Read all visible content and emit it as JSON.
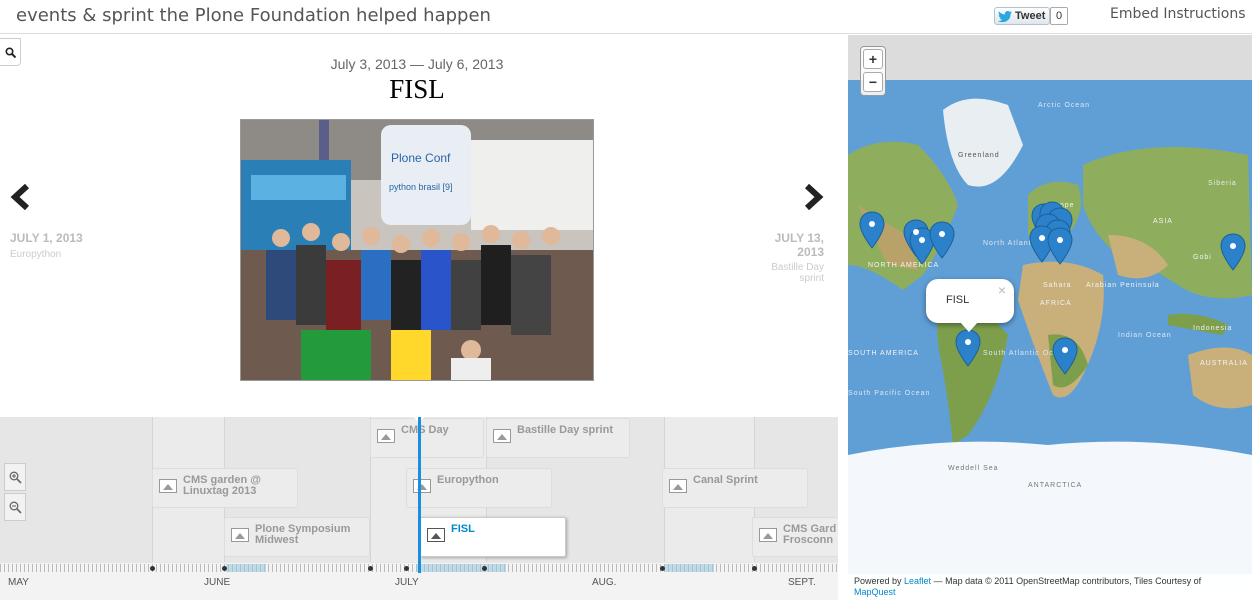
{
  "header": {
    "title": "events & sprint the Plone Foundation helped happen",
    "tweet_label": "Tweet",
    "tweet_count": "0",
    "embed_label": "Embed Instructions"
  },
  "slide": {
    "date_range": "July 3, 2013 — July 6, 2013",
    "title": "FISL",
    "photo_banner_text": "Plone Conf",
    "photo_sub_text": "python brasil [9]"
  },
  "nav": {
    "prev_date": "JULY 1, 2013",
    "prev_title": "Europython",
    "next_date_line1": "JULY 13,",
    "next_date_line2": "2013",
    "next_title_line1": "Bastille Day",
    "next_title_line2": "sprint"
  },
  "timeline": {
    "markers": [
      {
        "label_line1": "CMS Day",
        "label_line2": ""
      },
      {
        "label_line1": "Bastille Day sprint",
        "label_line2": ""
      },
      {
        "label_line1": "CMS garden @",
        "label_line2": "Linuxtag 2013"
      },
      {
        "label_line1": "Europython",
        "label_line2": ""
      },
      {
        "label_line1": "Canal Sprint",
        "label_line2": ""
      },
      {
        "label_line1": "Plone Symposium",
        "label_line2": "Midwest"
      },
      {
        "label_line1": "FISL",
        "label_line2": ""
      },
      {
        "label_line1": "CMS Gard",
        "label_line2": "Frosconn"
      }
    ],
    "months": [
      "MAY",
      "JUNE",
      "JULY",
      "AUG.",
      "SEPT."
    ]
  },
  "map": {
    "popup_text": "FISL",
    "popup_close": "×",
    "labels": {
      "arctic_ocean": "Arctic Ocean",
      "greenland": "Greenland",
      "siberia": "Siberia",
      "asia": "ASIA",
      "europe": "Europe",
      "north_america": "NORTH AMERICA",
      "sahara": "Sahara",
      "arabian": "Arabian Peninsula",
      "africa": "AFRICA",
      "gobi": "Gobi",
      "indonesia": "Indonesia",
      "south_america": "SOUTH AMERICA",
      "south_atlantic": "South Atlantic Ocean",
      "indian_ocean": "Indian Ocean",
      "australia": "AUSTRALIA",
      "south_pacific": "South Pacific Ocean",
      "weddell": "Weddell Sea",
      "antarctica": "ANTARCTICA",
      "north_atlantic": "North Atlantic Ocean"
    },
    "attribution_prefix": "Powered by ",
    "attribution_leaflet": "Leaflet",
    "attribution_middle": " — Map data © 2011 OpenStreetMap contributors, Tiles Courtesy of ",
    "attribution_mapquest": "MapQuest"
  },
  "colors": {
    "accent": "#1a8ee0",
    "marker_pin": "#2b82cb",
    "ocean": "#5f9fd6",
    "land": "#8fae5d",
    "ice": "#f4f7fb"
  }
}
